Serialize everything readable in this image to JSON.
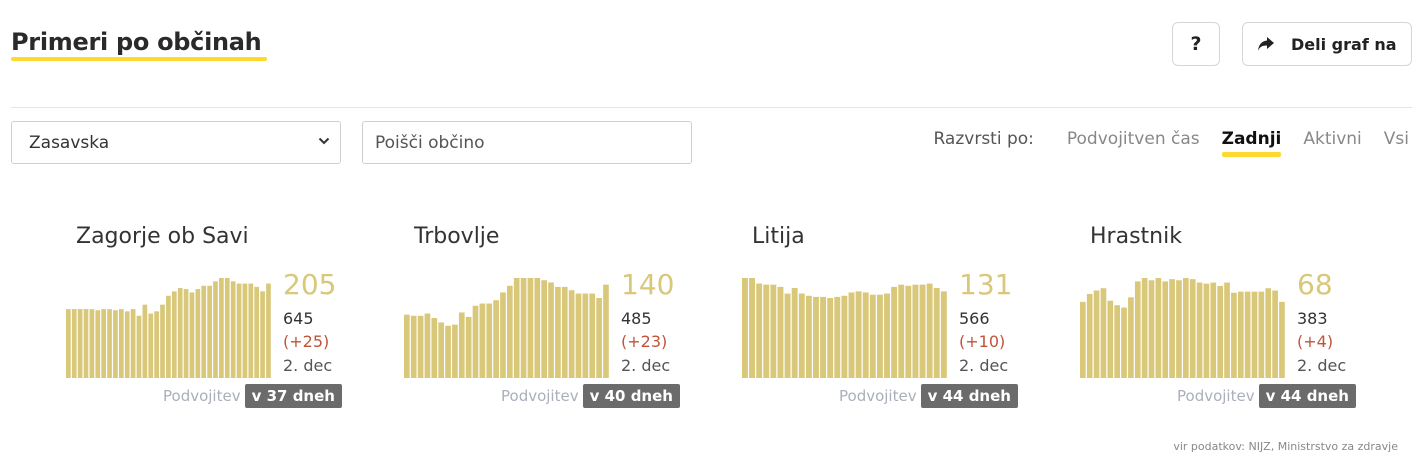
{
  "header": {
    "title": "Primeri po občinah",
    "help_label": "?",
    "share_label": "Deli graf na"
  },
  "filters": {
    "region_selected": "Zasavska",
    "search_placeholder": "Poišči občino",
    "sort_label": "Razvrsti po:",
    "sort_options": [
      "Podvojitven čas",
      "Zadnji",
      "Aktivni",
      "Vsi"
    ],
    "sort_active": "Zadnji"
  },
  "colors": {
    "accent": "#ffd92e",
    "bar": "#d9c87a",
    "delta": "#c0543a",
    "badge": "#6b6b6b"
  },
  "icons": {
    "share": "share-arrow-icon",
    "dropdown": "chevron-down-icon"
  },
  "cards": [
    {
      "name": "Zagorje ob Savi",
      "latest": "205",
      "total": "645",
      "delta": "(+25)",
      "date": "2. dec",
      "doubling_label": "Podvojitev",
      "doubling_value": "v 37 dneh",
      "bars": [
        62,
        62,
        62,
        62,
        62,
        61,
        62,
        62,
        61,
        62,
        60,
        62,
        56,
        66,
        58,
        60,
        66,
        74,
        78,
        81,
        80,
        77,
        80,
        83,
        83,
        87,
        90,
        90,
        87,
        85,
        85,
        85,
        82,
        78,
        85
      ]
    },
    {
      "name": "Trbovlje",
      "latest": "140",
      "total": "485",
      "delta": "(+23)",
      "date": "2. dec",
      "doubling_label": "Podvojitev",
      "doubling_value": "v 40 dneh",
      "bars": [
        57,
        56,
        56,
        58,
        54,
        50,
        47,
        48,
        59,
        55,
        65,
        67,
        67,
        70,
        77,
        83,
        90,
        90,
        90,
        90,
        88,
        86,
        82,
        82,
        79,
        76,
        76,
        76,
        72,
        84
      ]
    },
    {
      "name": "Litija",
      "latest": "131",
      "total": "566",
      "delta": "(+10)",
      "date": "2. dec",
      "doubling_label": "Podvojitev",
      "doubling_value": "v 44 dneh",
      "bars": [
        90,
        90,
        85,
        84,
        84,
        82,
        76,
        81,
        76,
        74,
        73,
        73,
        72,
        73,
        74,
        77,
        78,
        77,
        75,
        75,
        76,
        82,
        84,
        83,
        84,
        84,
        85,
        81,
        78
      ]
    },
    {
      "name": "Hrastnik",
      "latest": "68",
      "total": "383",
      "delta": "(+4)",
      "date": "2. dec",
      "doubling_label": "Podvojitev",
      "doubling_value": "v 44 dneh",
      "bars": [
        67,
        74,
        77,
        79,
        68,
        64,
        62,
        71,
        85,
        88,
        86,
        88,
        85,
        87,
        86,
        88,
        87,
        84,
        83,
        84,
        81,
        84,
        75,
        76,
        76,
        76,
        76,
        79,
        77,
        67
      ]
    }
  ],
  "footer": {
    "source": "vir podatkov: NIJZ, Ministrstvo za zdravje"
  }
}
